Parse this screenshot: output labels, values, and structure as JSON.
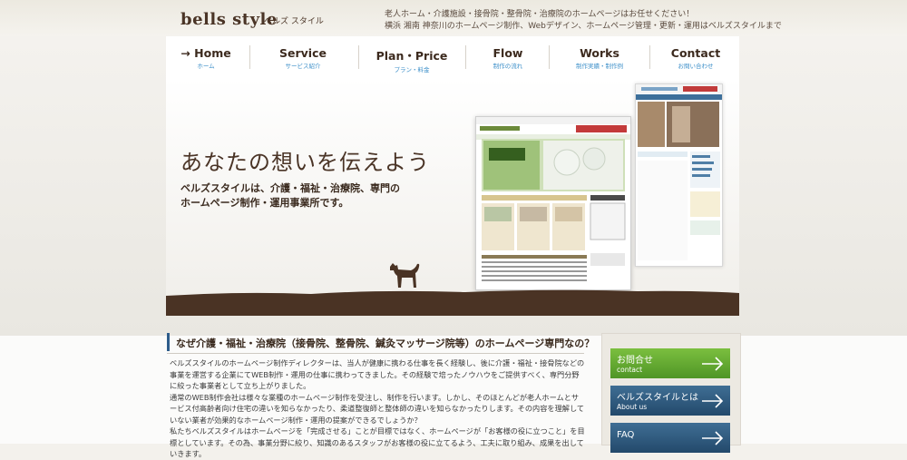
{
  "header": {
    "logo": "bells style",
    "logo_kana": "ベルズ スタイル",
    "tagline_1": "老人ホーム・介護施設・接骨院・整骨院・治療院のホームページはお任せください！",
    "tagline_2": "横浜 湘南 神奈川のホームページ制作、Webデザイン、ホームページ管理・更新・運用はベルズスタイルまで"
  },
  "nav": [
    {
      "en": "Home",
      "jp": "ホーム",
      "arrow": "→"
    },
    {
      "en": "Service",
      "jp": "サービス紹介"
    },
    {
      "en": "Plan・Price",
      "jp": "プラン・料金"
    },
    {
      "en": "Flow",
      "jp": "制作の流れ"
    },
    {
      "en": "Works",
      "jp": "制作実績・制作例"
    },
    {
      "en": "Contact",
      "jp": "お問い合わせ"
    }
  ],
  "hero": {
    "headline": "あなたの想いを伝えよう",
    "sub_1": "ベルズスタイルは、介護・福祉・治療院、専門の",
    "sub_2": "ホームページ制作・運用事業所です。"
  },
  "section": {
    "title": "なぜ介護・福祉・治療院（接骨院、整骨院、鍼灸マッサージ院等）のホームページ専門なの？",
    "paragraphs": [
      "ベルズスタイルのホームページ制作ディレクターは、当人が健康に携わる仕事を長く経験し、後に介護・福祉・接骨院などの事業を運営する企業にてWEB制作・運用の仕事に携わってきました。その経験で培ったノウハウをご提供すべく、専門分野に絞った事業者として立ち上がりました。",
      "通常のWEB制作会社は様々な業種のホームページ制作を受注し、制作を行います。しかし、そのほとんどが老人ホームとサービス付高齢者向け住宅の違いを知らなかったり、柔道整復師と整体師の違いを知らなかったりします。その内容を理解していない業者が効果的なホームページ制作・運用の提案ができるでしょうか？",
      "私たちベルズスタイルはホームページを「完成させる」ことが目標ではなく、ホームページが「お客様の役に立つこと」を目標としています。その為、事業分野に絞り、知識のあるスタッフがお客様の役に立てるよう、工夫に取り組み、成果を出していきます。"
    ]
  },
  "sidebar": [
    {
      "title": "お問合せ",
      "sub": "contact",
      "color": "#5fa832"
    },
    {
      "title": "ベルズスタイルとは",
      "sub": "About us",
      "color": "#2f5b80"
    },
    {
      "title": "FAQ",
      "sub": "",
      "color": "#2f5b80"
    }
  ],
  "colors": {
    "brand_brown": "#4a3426",
    "nav_sub_blue": "#3c8fc9",
    "heading_bar": "#2d5c8a"
  }
}
